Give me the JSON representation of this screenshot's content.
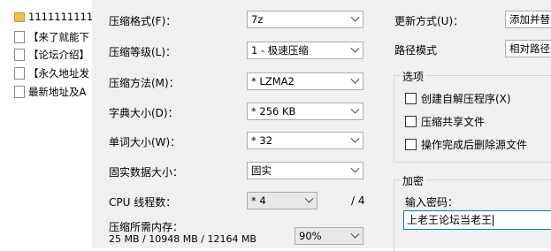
{
  "files": [
    {
      "name": "1111111111",
      "icon": "folder-icon"
    },
    {
      "name": "【来了就能下",
      "icon": "document-icon"
    },
    {
      "name": "【论坛介绍】",
      "icon": "document-icon"
    },
    {
      "name": "【永久地址发",
      "icon": "document-icon"
    },
    {
      "name": "最新地址及A",
      "icon": "document-icon"
    }
  ],
  "form": {
    "format_label": "压缩格式(F)：",
    "format_value": "7z",
    "level_label": "压缩等级(L)：",
    "level_value": "1 - 极速压缩",
    "method_label": "压缩方法(M)：",
    "method_value": "* LZMA2",
    "dict_label": "字典大小(D)：",
    "dict_value": "* 256 KB",
    "word_label": "单词大小(W)：",
    "word_value": "* 32",
    "solid_label": "固实数据大小：",
    "solid_value": "固实",
    "cpu_label": "CPU 线程数：",
    "cpu_value": "* 4",
    "cpu_max": "/ 4",
    "mem_label": "压缩所需内存：",
    "mem_value": "25 MB / 10948 MB / 12164 MB",
    "mem_percent": "90%",
    "update_label": "更新方式(U)：",
    "update_value": "添加并替",
    "path_label": "路径模式",
    "path_value": "相对路径"
  },
  "options": {
    "title": "选项",
    "sfx": "创建自解压程序(X)",
    "shared": "压缩共享文件",
    "delete": "操作完成后删除源文件"
  },
  "encryption": {
    "title": "加密",
    "password_label": "输入密码：",
    "password_value": "上老王论坛当老王"
  }
}
